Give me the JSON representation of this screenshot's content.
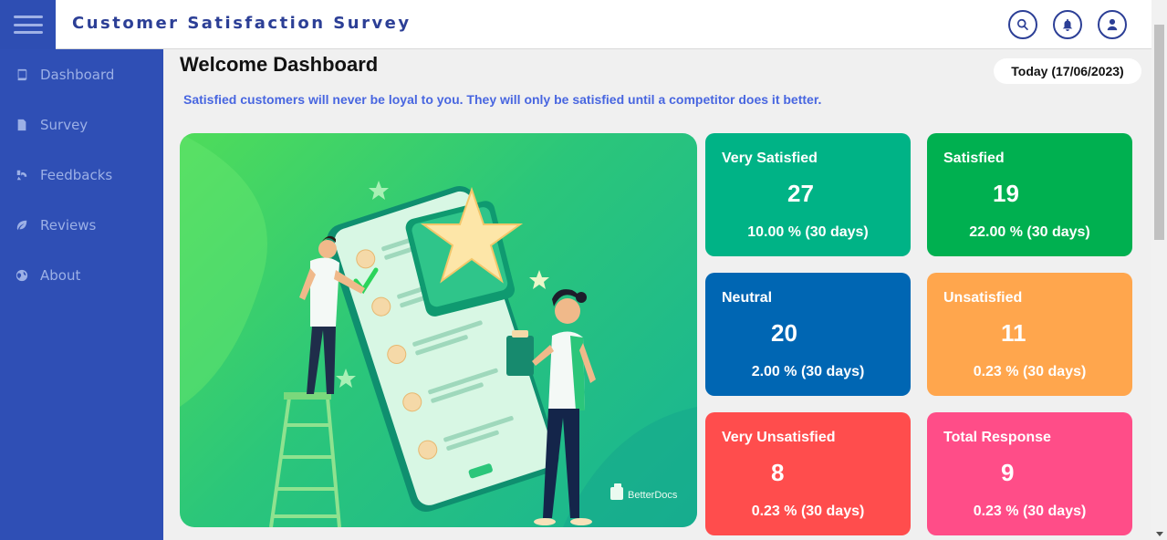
{
  "app": {
    "title": "Customer Satisfaction Survey"
  },
  "sidebar": {
    "items": [
      {
        "label": "Dashboard",
        "icon": "book-icon"
      },
      {
        "label": "Survey",
        "icon": "file-icon"
      },
      {
        "label": "Feedbacks",
        "icon": "feedback-icon"
      },
      {
        "label": "Reviews",
        "icon": "leaf-icon"
      },
      {
        "label": "About",
        "icon": "globe-icon"
      }
    ]
  },
  "header": {
    "icons": [
      "search-icon",
      "bell-icon",
      "user-icon"
    ]
  },
  "main": {
    "heading": "Welcome Dashboard",
    "date": "Today (17/06/2023)",
    "quote": "Satisfied customers will never be loyal to you. They will only be satisfied until a competitor does it better.",
    "hero_logo": "BetterDocs"
  },
  "cards": [
    {
      "title": "Very Satisfied",
      "value": "27",
      "sub": "10.00 % (30 days)",
      "color": "#00b386"
    },
    {
      "title": "Satisfied",
      "value": "19",
      "sub": "22.00 % (30 days)",
      "color": "#00b050"
    },
    {
      "title": "Neutral",
      "value": "20",
      "sub": "2.00 % (30 days)",
      "color": "#0066b3"
    },
    {
      "title": "Unsatisfied",
      "value": "11",
      "sub": "0.23 % (30 days)",
      "color": "#ffa64d"
    },
    {
      "title": "Very Unsatisfied",
      "value": "8",
      "sub": "0.23 % (30 days)",
      "color": "#ff4d4d"
    },
    {
      "title": "Total Response",
      "value": "9",
      "sub": "0.23 % (30 days)",
      "color": "#ff4d88"
    }
  ]
}
